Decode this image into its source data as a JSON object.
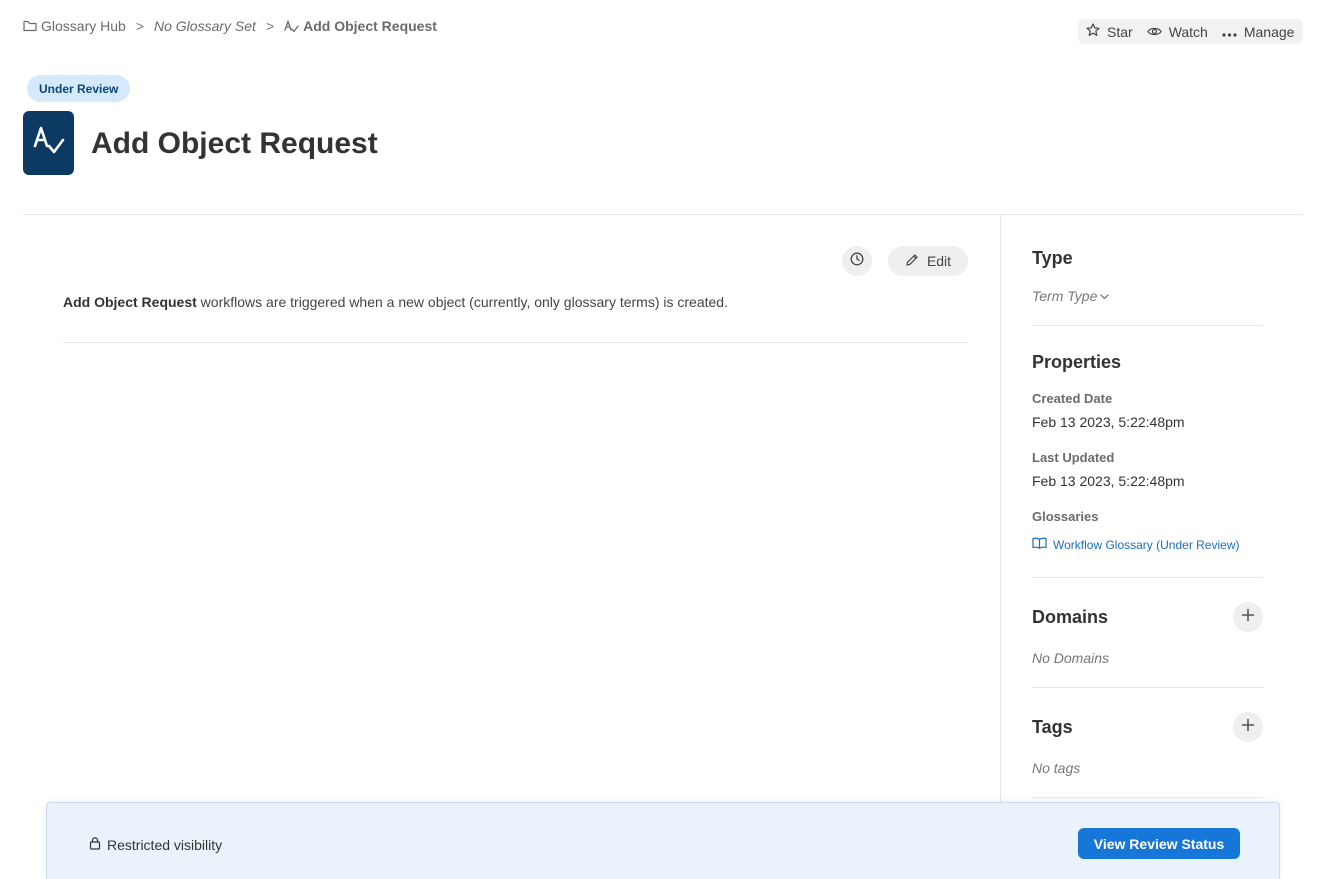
{
  "breadcrumb": {
    "hub": "Glossary Hub",
    "glossary_set": "No Glossary Set",
    "current": "Add Object Request",
    "separator": ">"
  },
  "top_actions": {
    "star": "Star",
    "watch": "Watch",
    "manage": "Manage"
  },
  "header": {
    "status": "Under Review",
    "title": "Add Object Request"
  },
  "main": {
    "edit_label": "Edit",
    "description_bold": "Add Object Request",
    "description_rest": " workflows are triggered when a new object (currently, only glossary terms) is created."
  },
  "sidebar": {
    "type_heading": "Type",
    "term_type": "Term Type",
    "properties_heading": "Properties",
    "created_label": "Created Date",
    "created_value": "Feb 13 2023, 5:22:48pm",
    "updated_label": "Last Updated",
    "updated_value": "Feb 13 2023, 5:22:48pm",
    "glossaries_label": "Glossaries",
    "glossary_link": "Workflow Glossary (Under Review)",
    "domains_heading": "Domains",
    "domains_empty": "No Domains",
    "tags_heading": "Tags",
    "tags_empty": "No tags"
  },
  "footer": {
    "restricted": "Restricted visibility",
    "review_button": "View Review Status"
  },
  "colors": {
    "status_bg": "#d5e9fa",
    "status_text": "#0a4677",
    "logo_bg": "#0d3a63",
    "link": "#1a6fc2",
    "primary_button": "#1677d9",
    "banner_bg": "#eaf3fb"
  }
}
